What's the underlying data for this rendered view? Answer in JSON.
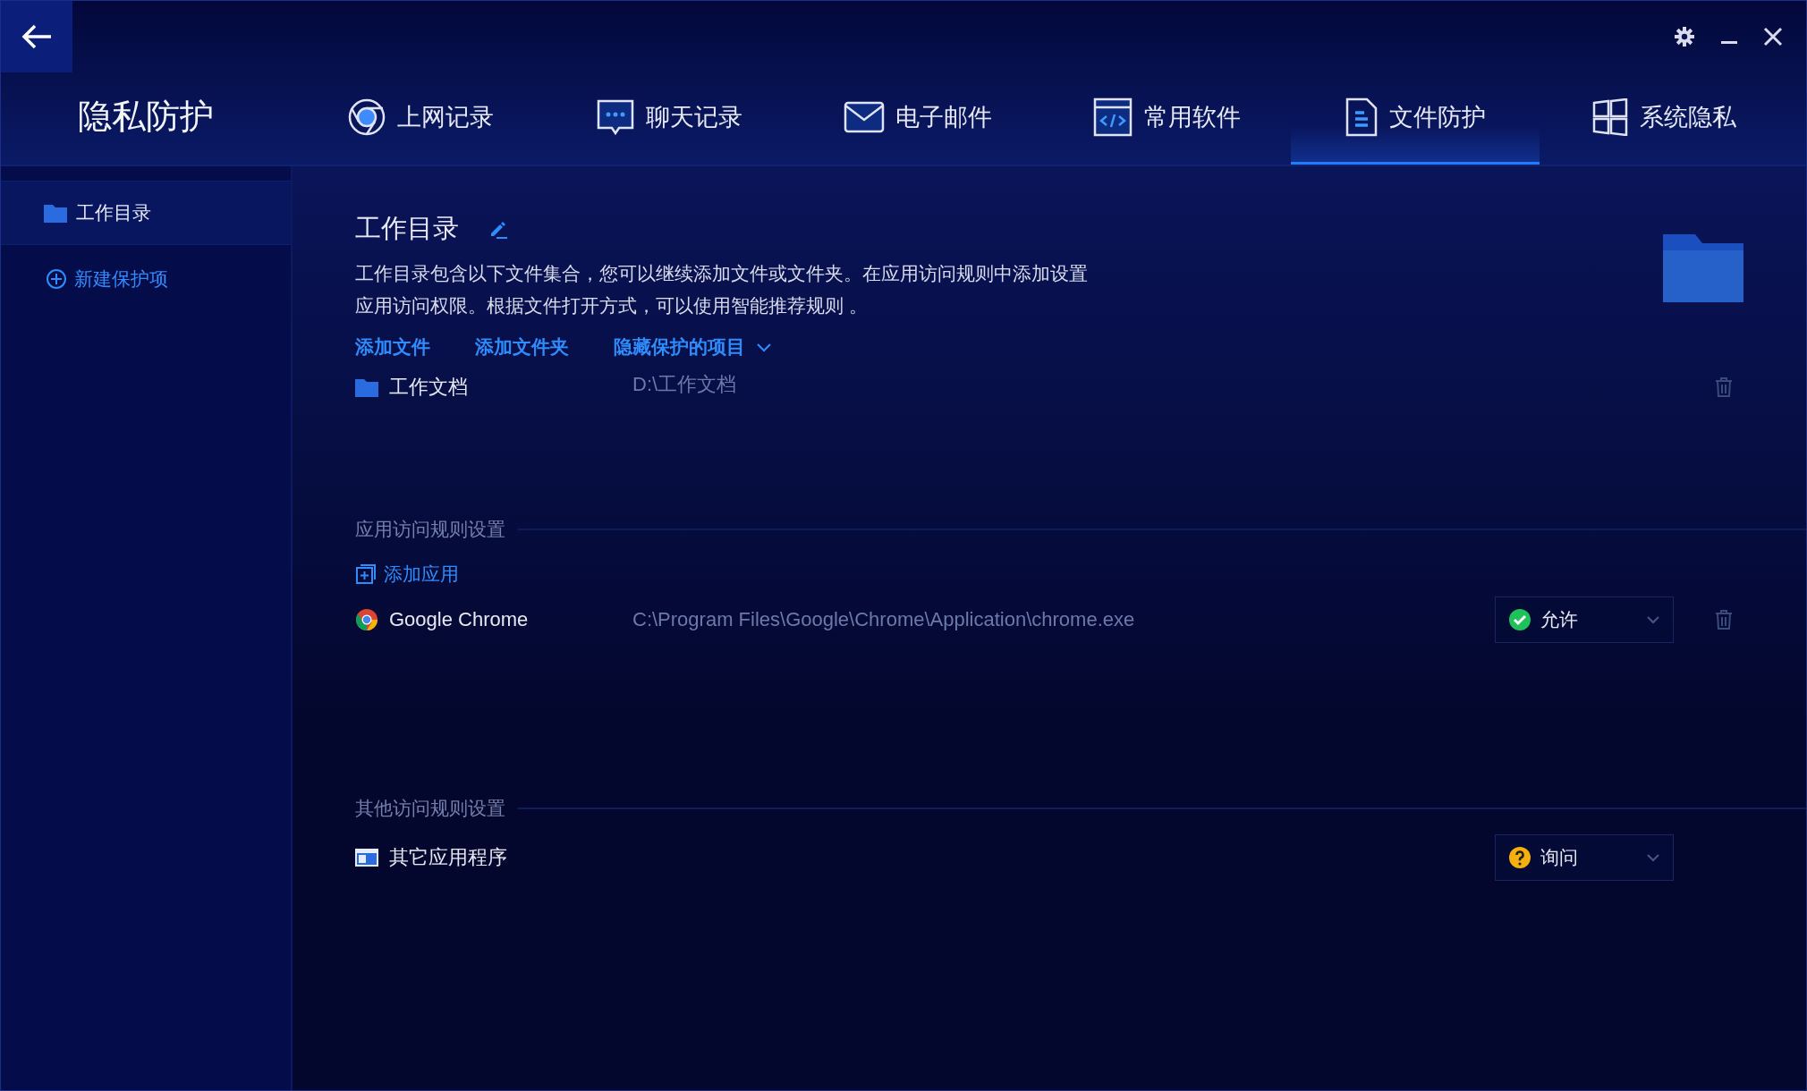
{
  "window": {
    "title": "隐私防护"
  },
  "tabs": [
    {
      "kind": "browser",
      "label": "上网记录",
      "selected": false
    },
    {
      "kind": "chat",
      "label": "聊天记录",
      "selected": false
    },
    {
      "kind": "mail",
      "label": "电子邮件",
      "selected": false
    },
    {
      "kind": "software",
      "label": "常用软件",
      "selected": false
    },
    {
      "kind": "file",
      "label": "文件防护",
      "selected": true
    },
    {
      "kind": "system",
      "label": "系统隐私",
      "selected": false
    }
  ],
  "sidebar": {
    "items": [
      {
        "label": "工作目录",
        "selected": true
      }
    ],
    "new_item": "新建保护项"
  },
  "directory": {
    "title": "工作目录",
    "description_lines": [
      "工作目录包含以下文件集合，您可以继续添加文件或文件夹。在应用访问规则中添加设置",
      "应用访问权限。根据文件打开方式，可以使用智能推荐规则 。"
    ],
    "actions": [
      "添加文件",
      "添加文件夹"
    ],
    "hidden_toggle": "隐藏保护的项目",
    "files": [
      {
        "name": "工作文档",
        "path": "D:\\工作文档"
      }
    ]
  },
  "app_rules": {
    "heading": "应用访问规则设置",
    "add_label": "添加应用",
    "rows": [
      {
        "name": "Google Chrome",
        "path": "C:\\Program Files\\Google\\Chrome\\Application\\chrome.exe",
        "permission": {
          "kind": "allow",
          "label": "允许"
        }
      }
    ]
  },
  "other_rules": {
    "heading": "其他访问规则设置",
    "rows": [
      {
        "name": "其它应用程序",
        "permission": {
          "kind": "ask",
          "label": "询问"
        }
      }
    ]
  }
}
